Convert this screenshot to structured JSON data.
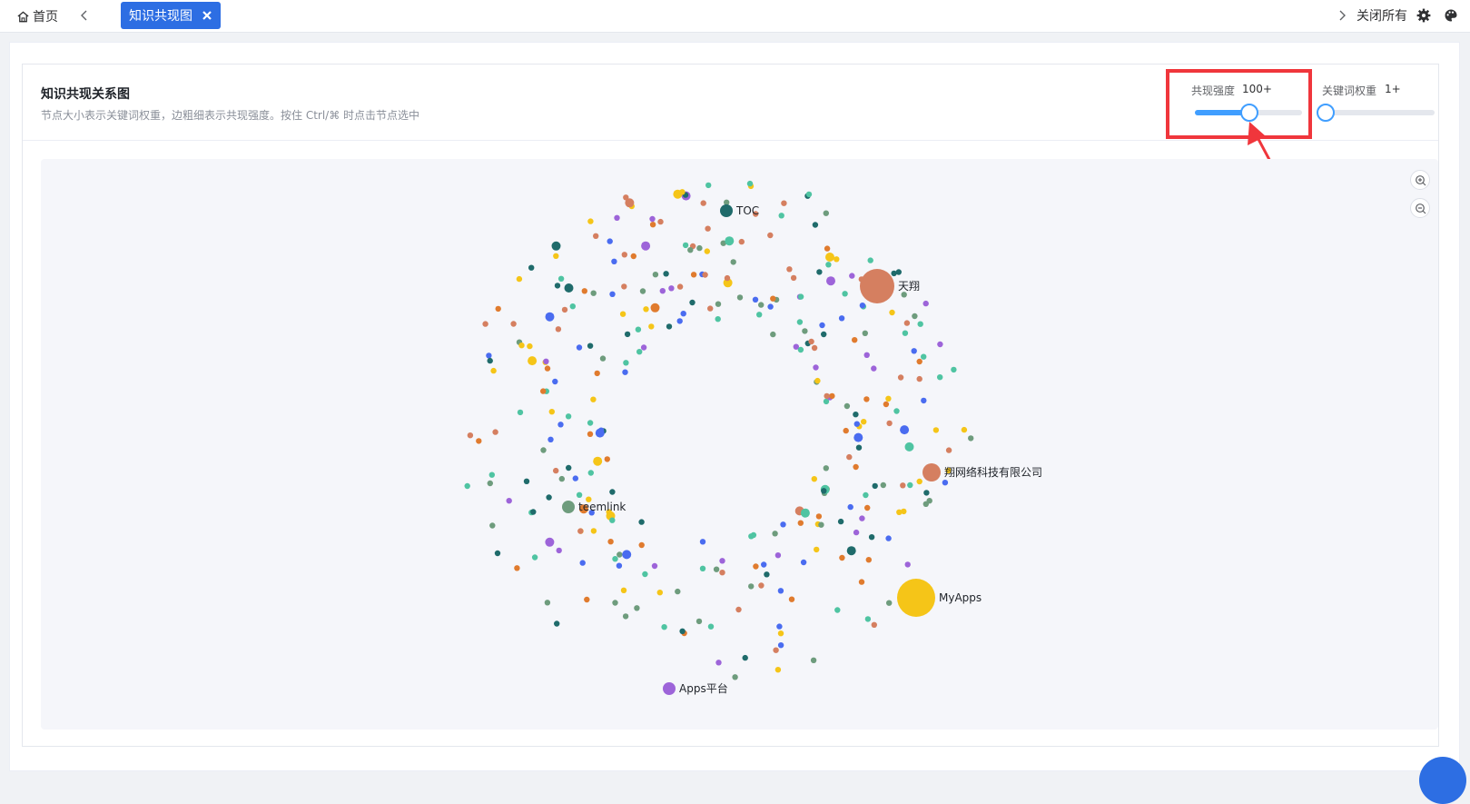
{
  "tabs": {
    "home_label": "首页",
    "active_tab_label": "知识共现图",
    "close_all_label": "关闭所有"
  },
  "card": {
    "title": "知识共现关系图",
    "subtitle": "节点大小表示关键词权重，边粗细表示共现强度。按住 Ctrl/⌘ 时点击节点选中"
  },
  "controls": {
    "cooccurrence": {
      "label": "共现强度",
      "value": "100+",
      "level": 0.5
    },
    "weight": {
      "label": "关键词权重",
      "value": "1+",
      "level": 0.0
    }
  },
  "graph": {
    "labeled_nodes": [
      "TOC",
      "天翔",
      "翔网络科技有限公司",
      "teemlink",
      "MyApps",
      "Apps平台"
    ],
    "node_colors": [
      "#e07b2e",
      "#f5c518",
      "#9d64d9",
      "#4a6cf0",
      "#4fc4a2",
      "#6e9c7d",
      "#d57f60",
      "#1f6b6b"
    ],
    "zoom_in_icon": "zoom-in-icon",
    "zoom_out_icon": "zoom-out-icon"
  }
}
